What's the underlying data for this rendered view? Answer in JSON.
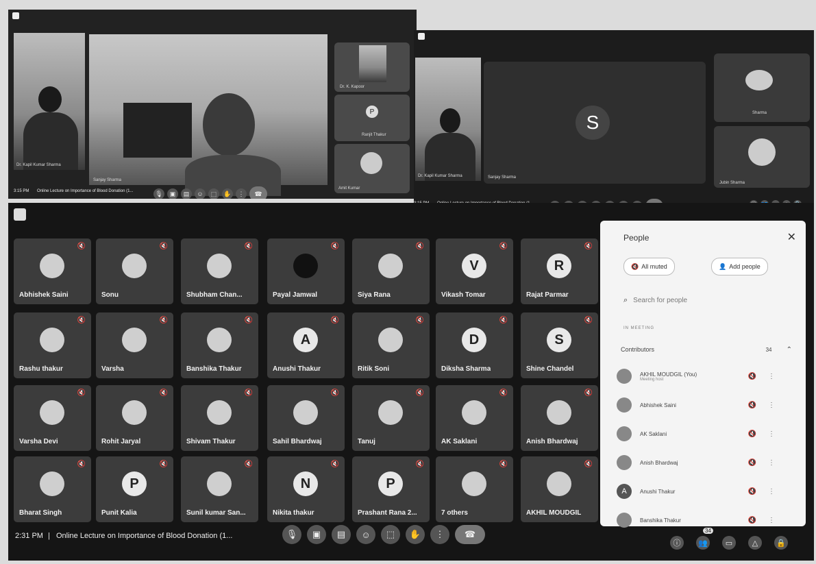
{
  "top_left": {
    "time": "3:15 PM",
    "meeting_title": "Online Lecture on Importance of Blood Donation (1...",
    "tile_names": [
      "Dr. Kapil Kumar Sharma",
      "Sanjay Sharma",
      "Dr. K. Kapoor",
      "Ranjit Thakur",
      "Amit Kumar"
    ],
    "tile_letters": [
      "P"
    ]
  },
  "top_right": {
    "time": "3:15 PM",
    "meeting_title": "Online Lecture on Importance of Blood Donation (1...",
    "big_letter": "S",
    "tile_names": [
      "Dr. Kapil Kumar Sharma",
      "Sanjay Sharma",
      "Sharma",
      "Jubin Sharma"
    ]
  },
  "grid": {
    "tiles": [
      {
        "name": "Abhishek Saini",
        "letter": "",
        "icon": "photo-avatar"
      },
      {
        "name": "Sonu",
        "letter": "",
        "icon": "photo-avatar"
      },
      {
        "name": "Shubham Chan...",
        "letter": "",
        "icon": "photo-avatar"
      },
      {
        "name": "Payal Jamwal",
        "letter": "",
        "icon": "dark-avatar"
      },
      {
        "name": "Siya Rana",
        "letter": "",
        "icon": "photo-avatar"
      },
      {
        "name": "Vikash Tomar",
        "letter": "V",
        "icon": "letter-avatar"
      },
      {
        "name": "Rajat Parmar",
        "letter": "R",
        "icon": "letter-avatar"
      },
      {
        "name": "Rashu thakur",
        "letter": "",
        "icon": "photo-avatar"
      },
      {
        "name": "Varsha",
        "letter": "",
        "icon": "photo-avatar"
      },
      {
        "name": "Banshika Thakur",
        "letter": "",
        "icon": "photo-avatar"
      },
      {
        "name": "Anushi Thakur",
        "letter": "A",
        "icon": "letter-avatar"
      },
      {
        "name": "Ritik Soni",
        "letter": "",
        "icon": "photo-avatar"
      },
      {
        "name": "Diksha Sharma",
        "letter": "D",
        "icon": "letter-avatar"
      },
      {
        "name": "Shine Chandel",
        "letter": "S",
        "icon": "letter-avatar"
      },
      {
        "name": "Varsha Devi",
        "letter": "",
        "icon": "photo-avatar"
      },
      {
        "name": "Rohit Jaryal",
        "letter": "",
        "icon": "photo-avatar"
      },
      {
        "name": "Shivam Thakur",
        "letter": "",
        "icon": "photo-avatar"
      },
      {
        "name": "Sahil Bhardwaj",
        "letter": "",
        "icon": "photo-avatar"
      },
      {
        "name": "Tanuj",
        "letter": "",
        "icon": "photo-avatar"
      },
      {
        "name": "AK Saklani",
        "letter": "",
        "icon": "photo-avatar"
      },
      {
        "name": "Anish Bhardwaj",
        "letter": "",
        "icon": "photo-avatar"
      },
      {
        "name": "Bharat Singh",
        "letter": "",
        "icon": "photo-avatar"
      },
      {
        "name": "Punit Kalia",
        "letter": "P",
        "icon": "letter-avatar"
      },
      {
        "name": "Sunil kumar San...",
        "letter": "",
        "icon": "photo-avatar"
      },
      {
        "name": "Nikita thakur",
        "letter": "N",
        "icon": "letter-avatar"
      },
      {
        "name": "Prashant Rana 2...",
        "letter": "P",
        "icon": "letter-avatar"
      },
      {
        "name": "7 others",
        "letter": "",
        "icon": "group-avatar"
      },
      {
        "name": "AKHIL MOUDGIL",
        "letter": "",
        "icon": "photo-avatar"
      }
    ]
  },
  "bottom_bar": {
    "time": "2:31 PM",
    "separator": "|",
    "meeting_title": "Online Lecture on Importance of Blood Donation (1...",
    "people_badge": "34"
  },
  "people_panel": {
    "title": "People",
    "all_muted": "All muted",
    "add_people": "Add people",
    "search_placeholder": "Search for people",
    "section": "IN MEETING",
    "group_label": "Contributors",
    "group_count": "34",
    "members": [
      {
        "name": "AKHIL MOUDGIL (You)",
        "sub": "Meeting host",
        "letter": ""
      },
      {
        "name": "Abhishek Saini",
        "sub": "",
        "letter": ""
      },
      {
        "name": "AK Saklani",
        "sub": "",
        "letter": ""
      },
      {
        "name": "Anish Bhardwaj",
        "sub": "",
        "letter": ""
      },
      {
        "name": "Anushi Thakur",
        "sub": "",
        "letter": "A"
      },
      {
        "name": "Banshika Thakur",
        "sub": "",
        "letter": ""
      }
    ]
  }
}
